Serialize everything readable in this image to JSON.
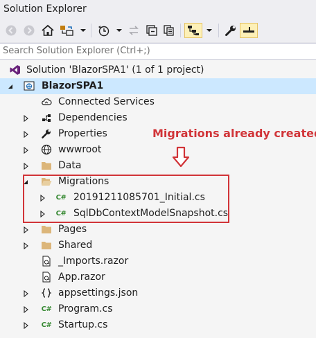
{
  "window": {
    "title": "Solution Explorer"
  },
  "search": {
    "placeholder": "Search Solution Explorer (Ctrl+;)"
  },
  "tree": {
    "solution": "Solution 'BlazorSPA1' (1 of 1 project)",
    "project": "BlazorSPA1",
    "items": [
      {
        "label": "Connected Services",
        "icon": "cloud-icon"
      },
      {
        "label": "Dependencies",
        "icon": "dependencies-icon"
      },
      {
        "label": "Properties",
        "icon": "wrench-icon"
      },
      {
        "label": "wwwroot",
        "icon": "globe-icon"
      },
      {
        "label": "Data",
        "icon": "folder-icon"
      },
      {
        "label": "Migrations",
        "icon": "open-folder-icon"
      },
      {
        "label": "20191211085701_Initial.cs",
        "icon": "csharp-file-icon"
      },
      {
        "label": "SqlDbContextModelSnapshot.cs",
        "icon": "csharp-file-icon"
      },
      {
        "label": "Pages",
        "icon": "folder-icon"
      },
      {
        "label": "Shared",
        "icon": "folder-icon"
      },
      {
        "label": "_Imports.razor",
        "icon": "razor-file-icon"
      },
      {
        "label": "App.razor",
        "icon": "razor-file-icon"
      },
      {
        "label": "appsettings.json",
        "icon": "json-file-icon"
      },
      {
        "label": "Program.cs",
        "icon": "csharp-file-icon"
      },
      {
        "label": "Startup.cs",
        "icon": "csharp-file-icon"
      }
    ],
    "cs_badge": "C#"
  },
  "annotation": {
    "text": "Migrations already created"
  },
  "colors": {
    "accent": "#d13438",
    "selection": "#cce8ff",
    "csharp": "#388a34"
  }
}
